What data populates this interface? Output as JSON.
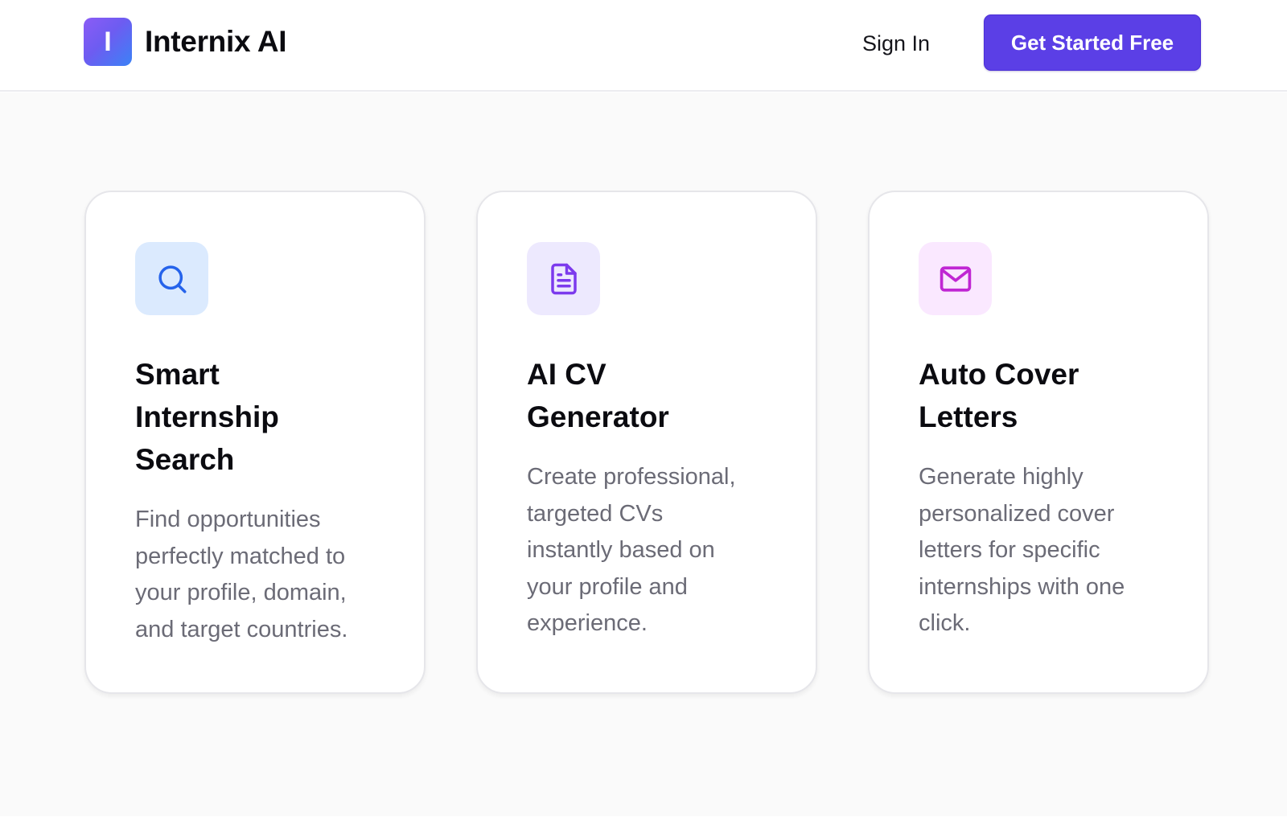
{
  "header": {
    "brand": {
      "logo_letter": "I",
      "name": "Internix AI"
    },
    "sign_in_label": "Sign In",
    "cta_label": "Get Started Free"
  },
  "features": [
    {
      "icon": "search-icon",
      "icon_color": "#2563eb",
      "icon_bg": "#dbeafe",
      "title_lines": [
        "Smart",
        "Internship",
        "Search"
      ],
      "description_lines": [
        "Find opportunities",
        "perfectly matched to",
        "your profile, domain,",
        "and target countries."
      ]
    },
    {
      "icon": "document-icon",
      "icon_color": "#7c3aed",
      "icon_bg": "#ede9fe",
      "title_lines": [
        "AI CV",
        "Generator"
      ],
      "description_lines": [
        "Create professional,",
        "targeted CVs",
        "instantly based on",
        "your profile and",
        "experience."
      ]
    },
    {
      "icon": "mail-icon",
      "icon_color": "#c026d3",
      "icon_bg": "#fae8ff",
      "title_lines": [
        "Auto Cover",
        "Letters"
      ],
      "description_lines": [
        "Generate highly",
        "personalized cover",
        "letters for specific",
        "internships with one",
        "click."
      ]
    }
  ],
  "colors": {
    "primary": "#5b3fe6",
    "background": "#fafafa",
    "text_muted": "#6b6b76"
  }
}
